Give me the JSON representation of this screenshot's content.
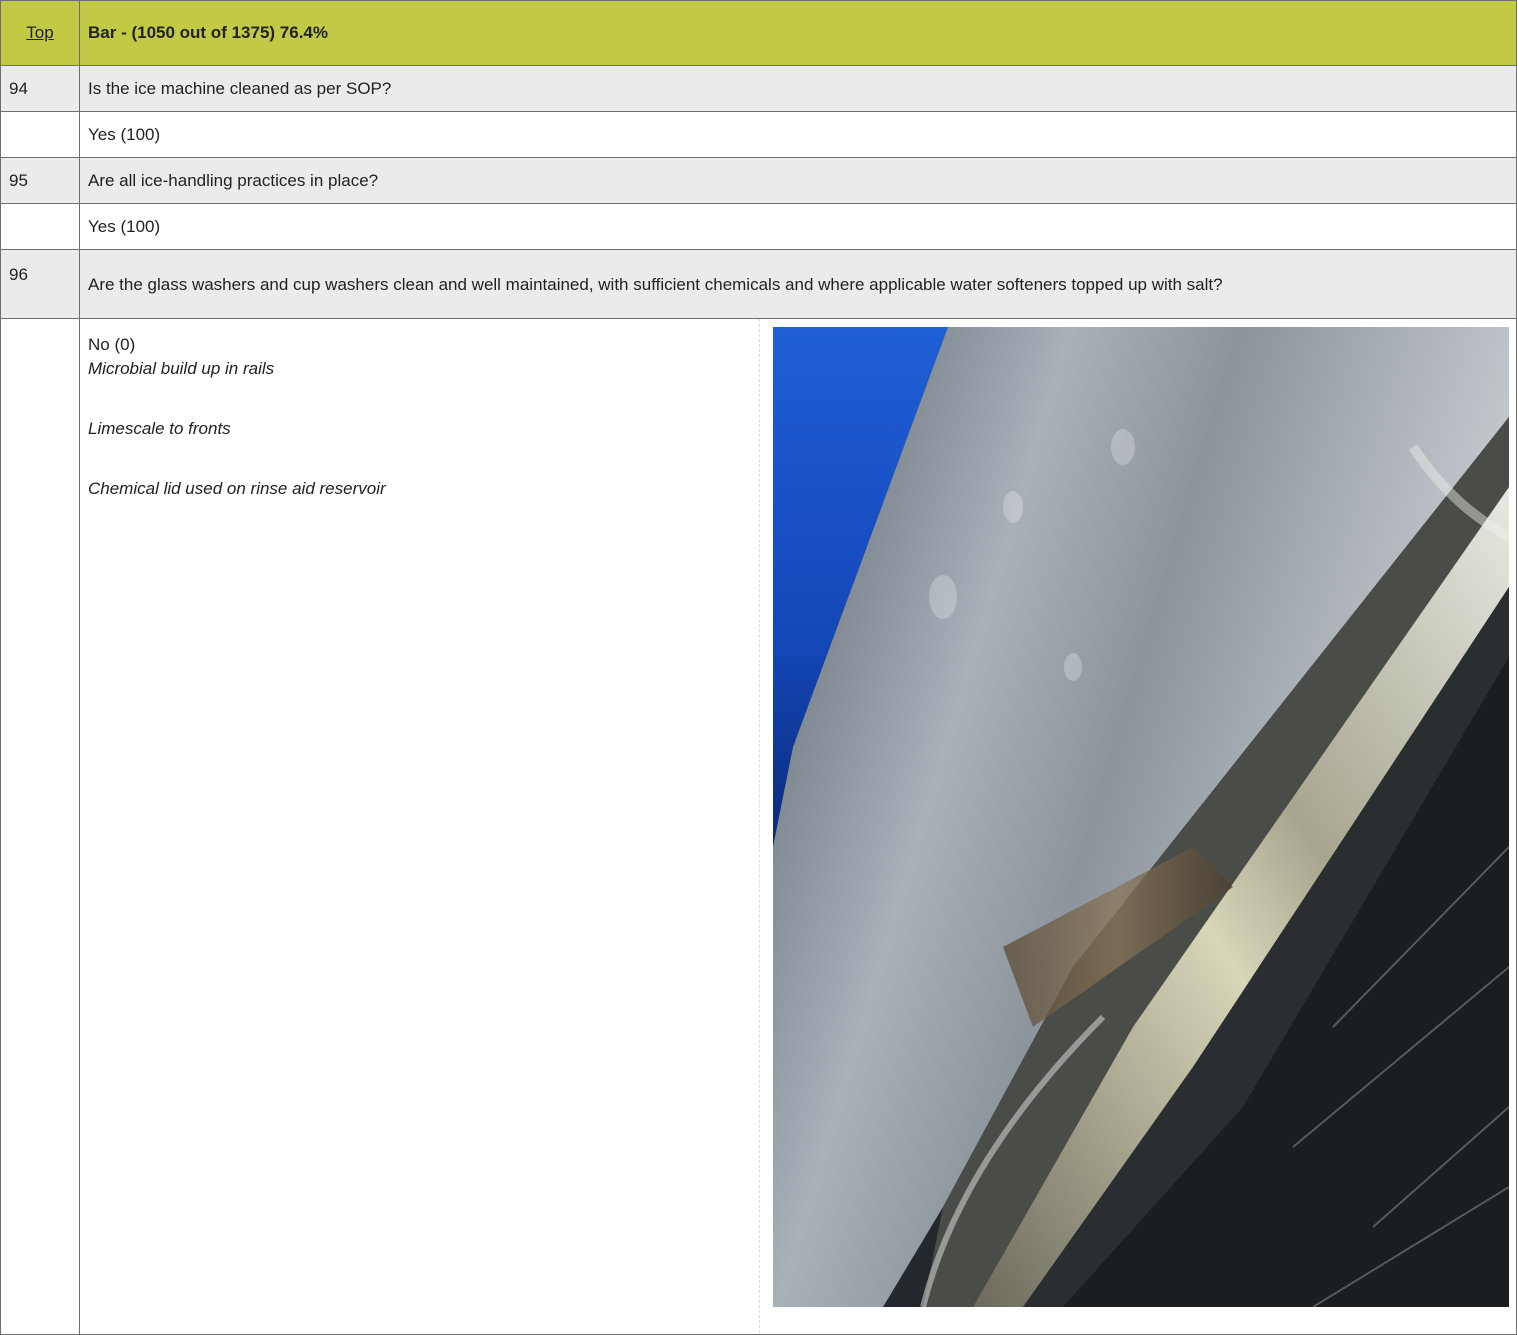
{
  "header": {
    "top_link": "Top",
    "section_title": "Bar - (1050 out of 1375) 76.4%"
  },
  "questions": [
    {
      "number": "94",
      "text": "Is the ice machine cleaned as per SOP?",
      "answer": "Yes (100)"
    },
    {
      "number": "95",
      "text": "Are all ice-handling practices in place?",
      "answer": "Yes (100)"
    },
    {
      "number": "96",
      "text": "Are the glass washers and cup washers clean and well maintained, with sufficient chemicals and where applicable water softeners topped up with salt?",
      "answer": "No (0)",
      "comments": [
        "Microbial build up in rails",
        "Limescale to fronts",
        "Chemical lid used on rinse aid reservoir"
      ]
    }
  ],
  "colors": {
    "header_bg": "#c2c944",
    "question_bg": "#ebebeb",
    "border": "#6f6f6f"
  }
}
